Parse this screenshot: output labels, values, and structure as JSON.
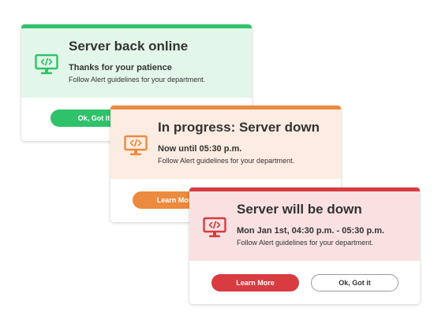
{
  "colors": {
    "green": "#2fc26b",
    "green_bg": "#e3f6ea",
    "orange": "#ec8a3e",
    "orange_bg": "#fdece2",
    "red": "#d83b40",
    "red_bg": "#f9e1e2"
  },
  "alerts": [
    {
      "status": "online",
      "icon": "monitor-code-icon",
      "title": "Server back online",
      "subtitle": "Thanks for your patience",
      "message": "Follow Alert guidelines for your department.",
      "primary_label": "Ok, Got it"
    },
    {
      "status": "in-progress",
      "icon": "monitor-code-icon",
      "title": "In progress: Server down",
      "subtitle": "Now until 05:30 p.m.",
      "message": "Follow Alert guidelines for your department.",
      "primary_label": "Learn More"
    },
    {
      "status": "scheduled",
      "icon": "monitor-code-icon",
      "title": "Server will be down",
      "subtitle": "Mon Jan 1st, 04:30 p.m. - 05:30 p.m.",
      "message": "Follow Alert guidelines for your department.",
      "primary_label": "Learn More",
      "secondary_label": "Ok, Got it"
    }
  ]
}
